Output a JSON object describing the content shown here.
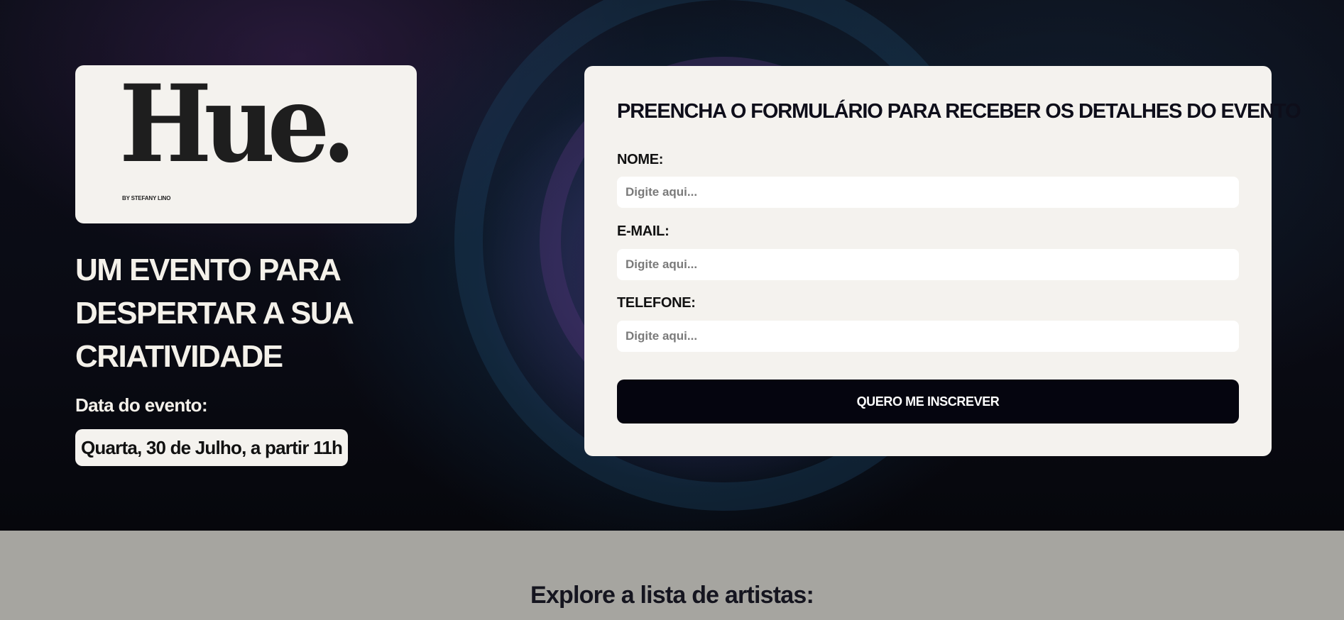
{
  "hero": {
    "logo": {
      "wordmark": "Hue.",
      "byline": "BY STEFANY LINO"
    },
    "headline": "UM EVENTO PARA DESPERTAR A SUA CRIATIVIDADE",
    "date_label": "Data do evento:",
    "date_value": "Quarta, 30 de Julho, a partir 11h"
  },
  "form": {
    "title": "PREENCHA O FORMULÁRIO PARA RECEBER OS DETALHES DO EVENTO",
    "fields": [
      {
        "label": "NOME:",
        "placeholder": "Digite aqui...",
        "value": ""
      },
      {
        "label": "E-MAIL:",
        "placeholder": "Digite aqui...",
        "value": ""
      },
      {
        "label": "TELEFONE:",
        "placeholder": "Digite aqui...",
        "value": ""
      }
    ],
    "submit_label": "QUERO ME INSCREVER"
  },
  "artists": {
    "title": "Explore a lista de artistas:"
  },
  "colors": {
    "card_background": "#f4f2ee",
    "button_background": "#05050f",
    "lower_section_background": "#a6a5a0",
    "hero_text": "#f4f1ea"
  }
}
